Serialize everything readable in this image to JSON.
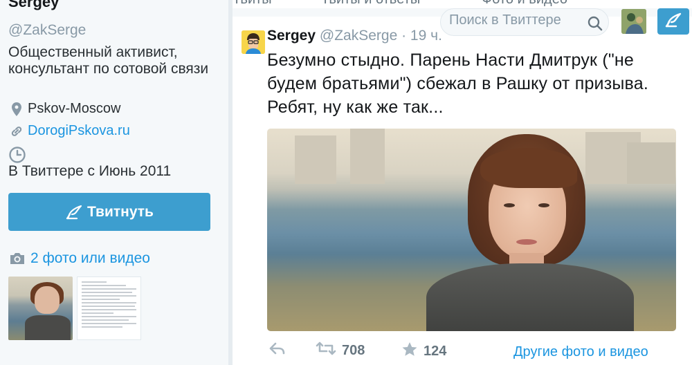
{
  "profile": {
    "name": "Sergey",
    "handle": "@ZakSerge",
    "bio": "Общественный активист, консультант по сотовой связи",
    "location": "Pskov-Moscow",
    "website": "DorogiPskova.ru",
    "joined": "В Твиттере с Июнь 2011",
    "tweet_button": "Твитнуть",
    "photos_link": "2 фото или видео"
  },
  "top_nav": {
    "tabs": [
      "Твиты",
      "Твиты и ответы",
      "Фото и видео"
    ],
    "search_placeholder": "Поиск в Твиттере"
  },
  "tweet": {
    "author_name": "Sergey",
    "author_handle": "@ZakSerge",
    "time": "· 19 ч.",
    "text": "Безумно стыдно. Парень Насти Дмитрук (\"не будем братьями\") сбежал в Рашку от призыва. Ребят, ну как же так...",
    "retweets": "708",
    "likes": "124",
    "more_media": "Другие фото и видео"
  },
  "colors": {
    "accent": "#1b95e0",
    "button": "#3d9ecf",
    "muted": "#8899a6"
  },
  "icons": [
    "location-icon",
    "link-icon",
    "clock-icon",
    "compose-icon",
    "camera-icon",
    "search-icon",
    "reply-icon",
    "retweet-icon",
    "like-icon"
  ]
}
